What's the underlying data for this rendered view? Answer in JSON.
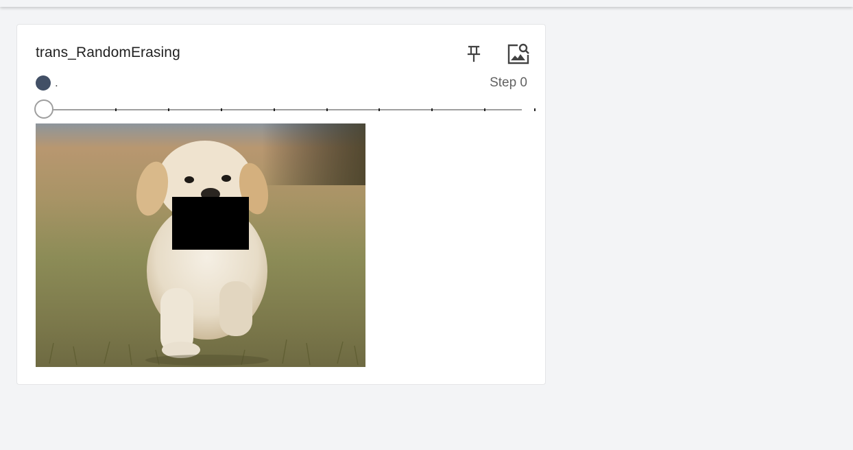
{
  "card": {
    "title": "trans_RandomErasing",
    "run_name": ".",
    "run_color": "#425066",
    "step_label": "Step 0",
    "actions": [
      {
        "name": "pin-icon"
      },
      {
        "name": "image-search-icon"
      }
    ]
  },
  "slider": {
    "current_step_index": 0,
    "tick_count": 10
  },
  "image": {
    "description_icon": "dog-photo",
    "erased_region_color": "#000000"
  }
}
